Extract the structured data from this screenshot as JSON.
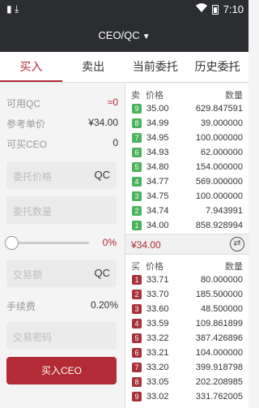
{
  "status_bar": {
    "left_icons": "▮ ⤓",
    "time": "7:10",
    "wifi_icon": "wifi-icon",
    "battery_icon": "battery-icon"
  },
  "header": {
    "title": "CEO/QC",
    "chevron_icon": "chevron-down-icon"
  },
  "tabs": [
    {
      "label": "买入",
      "active": true
    },
    {
      "label": "卖出",
      "active": false
    },
    {
      "label": "当前委托",
      "active": false
    },
    {
      "label": "历史委托",
      "active": false
    }
  ],
  "form": {
    "available_label": "可用QC",
    "available_value": "≈0",
    "ref_price_label": "参考单价",
    "ref_price_value": "¥34.00",
    "can_buy_label": "可买CEO",
    "can_buy_value": "0",
    "price_placeholder": "委托价格",
    "price_unit": "QC",
    "qty_placeholder": "委托数量",
    "slider_percent": "0%",
    "slider_value": 0,
    "amount_placeholder": "交易额",
    "amount_unit": "QC",
    "fee_label": "手续费",
    "fee_value": "0.20%",
    "password_placeholder": "交易密码",
    "submit_label": "买入CEO"
  },
  "sell_book": {
    "head_side": "卖",
    "head_price": "价格",
    "head_qty": "数量",
    "rows": [
      {
        "idx": "9",
        "price": "35.00",
        "qty": "629.847591"
      },
      {
        "idx": "8",
        "price": "34.99",
        "qty": "39.000000"
      },
      {
        "idx": "7",
        "price": "34.95",
        "qty": "100.000000"
      },
      {
        "idx": "6",
        "price": "34.93",
        "qty": "62.000000"
      },
      {
        "idx": "5",
        "price": "34.80",
        "qty": "154.000000"
      },
      {
        "idx": "4",
        "price": "34.77",
        "qty": "569.000000"
      },
      {
        "idx": "3",
        "price": "34.75",
        "qty": "100.000000"
      },
      {
        "idx": "2",
        "price": "34.74",
        "qty": "7.943991"
      },
      {
        "idx": "1",
        "price": "34.00",
        "qty": "858.928994"
      }
    ]
  },
  "last_price": "¥34.00",
  "swap_icon": "swap-icon",
  "buy_book": {
    "head_side": "买",
    "head_price": "价格",
    "head_qty": "数量",
    "rows": [
      {
        "idx": "1",
        "price": "33.71",
        "qty": "80.000000"
      },
      {
        "idx": "2",
        "price": "33.70",
        "qty": "185.500000"
      },
      {
        "idx": "3",
        "price": "33.60",
        "qty": "48.500000"
      },
      {
        "idx": "4",
        "price": "33.59",
        "qty": "109.861899"
      },
      {
        "idx": "5",
        "price": "33.22",
        "qty": "387.426896"
      },
      {
        "idx": "6",
        "price": "33.21",
        "qty": "104.000000"
      },
      {
        "idx": "7",
        "price": "33.20",
        "qty": "399.918798"
      },
      {
        "idx": "8",
        "price": "33.05",
        "qty": "202.208985"
      },
      {
        "idx": "9",
        "price": "33.02",
        "qty": "331.762005"
      }
    ]
  },
  "colors": {
    "accent": "#b22b35",
    "sell_badge": "#4bb35a",
    "buy_badge": "#a8323a",
    "header_bg": "#2b2d31"
  }
}
